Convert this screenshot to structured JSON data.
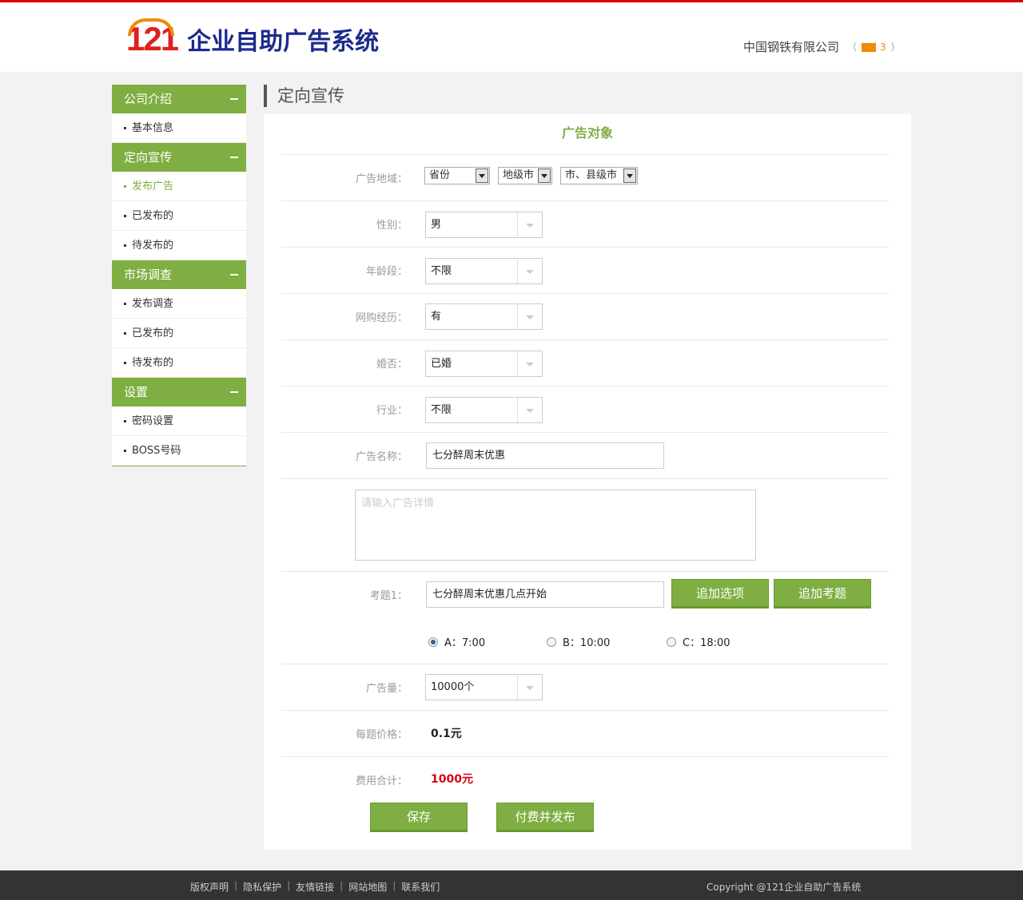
{
  "header": {
    "logo_number": "121",
    "logo_text": "企业自助广告系统",
    "company": "中国钢铁有限公司",
    "mail_open": "（",
    "mail_count": "3",
    "mail_close": "）"
  },
  "sidebar": {
    "groups": [
      {
        "label": "公司介绍",
        "items": [
          "基本信息"
        ]
      },
      {
        "label": "定向宣传",
        "items": [
          "发布广告",
          "已发布的",
          "待发布的"
        ]
      },
      {
        "label": "市场调查",
        "items": [
          "发布调查",
          "已发布的",
          "待发布的"
        ]
      },
      {
        "label": "设置",
        "items": [
          "密码设置",
          "BOSS号码"
        ]
      }
    ],
    "active_item": "发布广告"
  },
  "page_title": "定向宣传",
  "form": {
    "section_title": "广告对象",
    "region": {
      "label": "广告地域：",
      "province": "省份",
      "city": "地级市",
      "county": "市、县级市"
    },
    "gender": {
      "label": "性别：",
      "value": "男"
    },
    "age": {
      "label": "年龄段：",
      "value": "不限"
    },
    "shopping": {
      "label": "网购经历：",
      "value": "有"
    },
    "marriage": {
      "label": "婚否：",
      "value": "已婚"
    },
    "industry": {
      "label": "行业：",
      "value": "不限"
    },
    "ad_name": {
      "label": "广告名称：",
      "value": "七分醉周末优惠"
    },
    "detail": {
      "placeholder": "请输入广告详情"
    },
    "question": {
      "label": "考题1：",
      "value": "七分醉周末优惠几点开始",
      "add_option": "追加选项",
      "add_question": "追加考题",
      "options": [
        {
          "text": "A：7:00",
          "selected": true
        },
        {
          "text": "B：10:00",
          "selected": false
        },
        {
          "text": "C：18:00",
          "selected": false
        }
      ]
    },
    "quantity": {
      "label": "广告量：",
      "value": "10000个"
    },
    "price": {
      "label": "每题价格：",
      "value": "0.1元"
    },
    "total": {
      "label": "费用合计：",
      "value": "1000元"
    },
    "save": "保存",
    "pay_publish": "付费并发布"
  },
  "footer": {
    "links": [
      "版权声明",
      "隐私保护",
      "友情链接",
      "网站地图",
      "联系我们"
    ],
    "separator": "|",
    "copyright": "Copyright @121企业自助广告系统"
  },
  "colors": {
    "accent_green": "#7fae42",
    "brand_red": "#d7000f",
    "logo_blue": "#1b2a8c",
    "logo_orange": "#f08a00"
  }
}
